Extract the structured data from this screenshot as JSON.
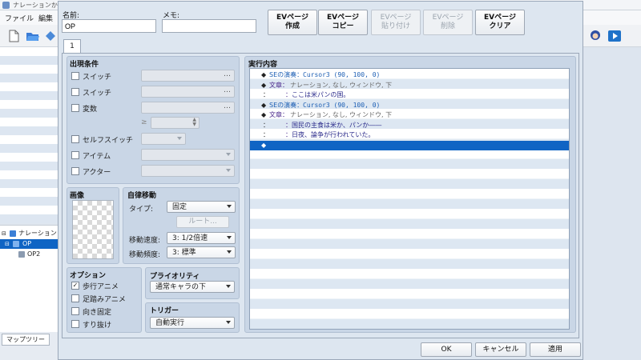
{
  "app": {
    "window_title": "ナレーションから始まる",
    "menu": [
      "ファイル",
      "編集"
    ],
    "tree": {
      "items": [
        "ナレーション",
        "OP",
        "OP2"
      ]
    },
    "bottom_tab": "マップツリー"
  },
  "dialog": {
    "name_label": "名前:",
    "name_value": "OP",
    "memo_label": "メモ:",
    "memo_value": "",
    "page_buttons": [
      {
        "label": "EVページ\n作成",
        "enabled": true
      },
      {
        "label": "EVページ\nコピー",
        "enabled": true
      },
      {
        "label": "EVページ\n貼り付け",
        "enabled": false
      },
      {
        "label": "EVページ\n削除",
        "enabled": false
      },
      {
        "label": "EVページ\nクリア",
        "enabled": true
      }
    ],
    "page_tab": "1",
    "conditions": {
      "title": "出現条件",
      "switch1": "スイッチ",
      "switch2": "スイッチ",
      "variable": "変数",
      "gte": "≥",
      "self_switch": "セルフスイッチ",
      "item": "アイテム",
      "actor": "アクター"
    },
    "image": {
      "title": "画像"
    },
    "autonomous": {
      "title": "自律移動",
      "type_label": "タイプ:",
      "type_value": "固定",
      "route_button": "ルート...",
      "speed_label": "移動速度:",
      "speed_value": "3: 1/2倍速",
      "freq_label": "移動頻度:",
      "freq_value": "3: 標準"
    },
    "options": {
      "title": "オプション",
      "items": [
        {
          "label": "歩行アニメ",
          "checked": true
        },
        {
          "label": "足踏みアニメ",
          "checked": false
        },
        {
          "label": "向き固定",
          "checked": false
        },
        {
          "label": "すり抜け",
          "checked": false
        }
      ]
    },
    "priority": {
      "title": "プライオリティ",
      "value": "通常キャラの下"
    },
    "trigger": {
      "title": "トリガー",
      "value": "自動実行"
    },
    "contents": {
      "title": "実行内容",
      "commands": [
        {
          "prefix": "◆",
          "label": "SEの演奏：",
          "detail": "Cursor3 (90, 100, 0)",
          "kind": "se"
        },
        {
          "prefix": "◆",
          "label": "文章：",
          "detail": "ナレーション, なし, ウィンドウ, 下",
          "kind": "text"
        },
        {
          "prefix": "：",
          "label": "：",
          "detail": "ここは米パンの国。",
          "kind": "line"
        },
        {
          "prefix": "◆",
          "label": "SEの演奏：",
          "detail": "Cursor3 (90, 100, 0)",
          "kind": "se"
        },
        {
          "prefix": "◆",
          "label": "文章：",
          "detail": "ナレーション, なし, ウィンドウ, 下",
          "kind": "text"
        },
        {
          "prefix": "：",
          "label": "：",
          "detail": "国民の主食は米か、パンか――",
          "kind": "line"
        },
        {
          "prefix": "：",
          "label": "：",
          "detail": "日夜、論争が行われていた。",
          "kind": "line"
        },
        {
          "prefix": "◆",
          "label": "",
          "detail": "",
          "kind": "empty"
        }
      ]
    },
    "footer": {
      "ok": "OK",
      "cancel": "キャンセル",
      "apply": "適用"
    }
  },
  "colors": {
    "selection": "#0f64c4",
    "se_cmd": "#1d5fb4",
    "text_cmd": "#4b2a8c"
  }
}
